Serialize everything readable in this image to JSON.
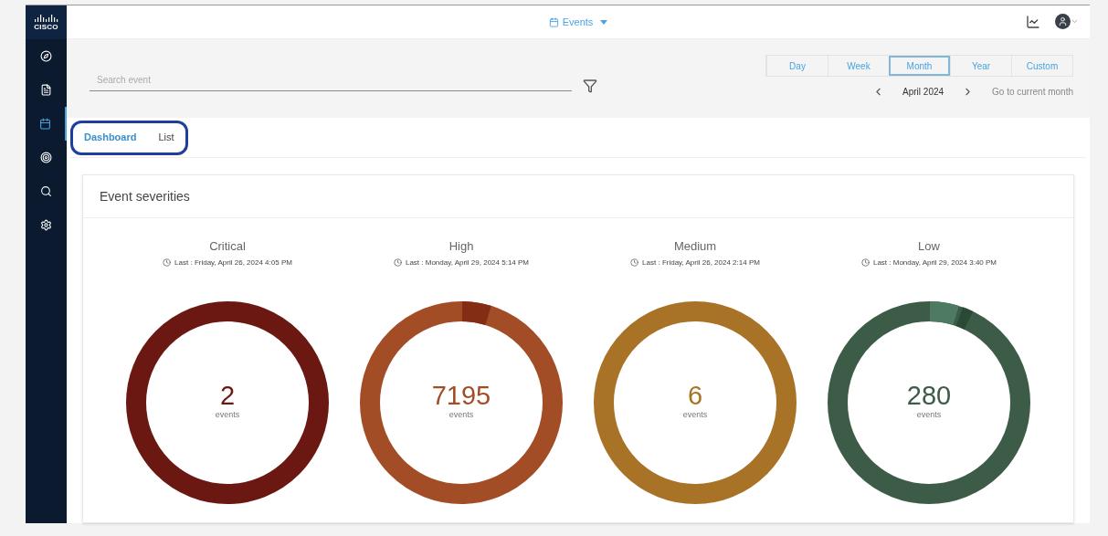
{
  "sidebar": {
    "logo": {
      "text": "CISCO"
    },
    "items": [
      {
        "kind": "compass",
        "selected": false
      },
      {
        "kind": "document",
        "selected": false
      },
      {
        "kind": "calendar",
        "selected": true
      },
      {
        "kind": "target",
        "selected": false
      },
      {
        "kind": "search",
        "selected": false
      },
      {
        "kind": "settings",
        "selected": false
      }
    ]
  },
  "header": {
    "app_menu": "Events"
  },
  "toolbar": {
    "search": {
      "placeholder": "Search event"
    },
    "ranges": [
      {
        "label": "Day",
        "selected": false
      },
      {
        "label": "Week",
        "selected": false
      },
      {
        "label": "Month",
        "selected": true
      },
      {
        "label": "Year",
        "selected": false
      },
      {
        "label": "Custom",
        "selected": false
      }
    ],
    "period": "April 2024",
    "current_link": "Go to current month"
  },
  "tabs": [
    {
      "label": "Dashboard",
      "selected": true
    },
    {
      "label": "List",
      "selected": false
    }
  ],
  "card": {
    "title": "Event severities",
    "gauges": [
      {
        "name": "Critical",
        "last": "Last : Friday, April 26, 2024 4:05 PM",
        "count": "2",
        "unit": "events",
        "color": "#6b1812"
      },
      {
        "name": "High",
        "last": "Last : Monday, April 29, 2024 5:14 PM",
        "count": "7195",
        "unit": "events",
        "color": "#a34d27",
        "slices": [
          {
            "color": "#832e14"
          }
        ]
      },
      {
        "name": "Medium",
        "last": "Last : Friday, April 26, 2024 2:14 PM",
        "count": "6",
        "unit": "events",
        "color": "#a87326"
      },
      {
        "name": "Low",
        "last": "Last : Monday, April 29, 2024 3:40 PM",
        "count": "280",
        "unit": "events",
        "color": "#3d5c47",
        "slices": [
          {
            "color": "#4f7a62"
          },
          {
            "color": "#2b4a35"
          }
        ]
      }
    ]
  }
}
